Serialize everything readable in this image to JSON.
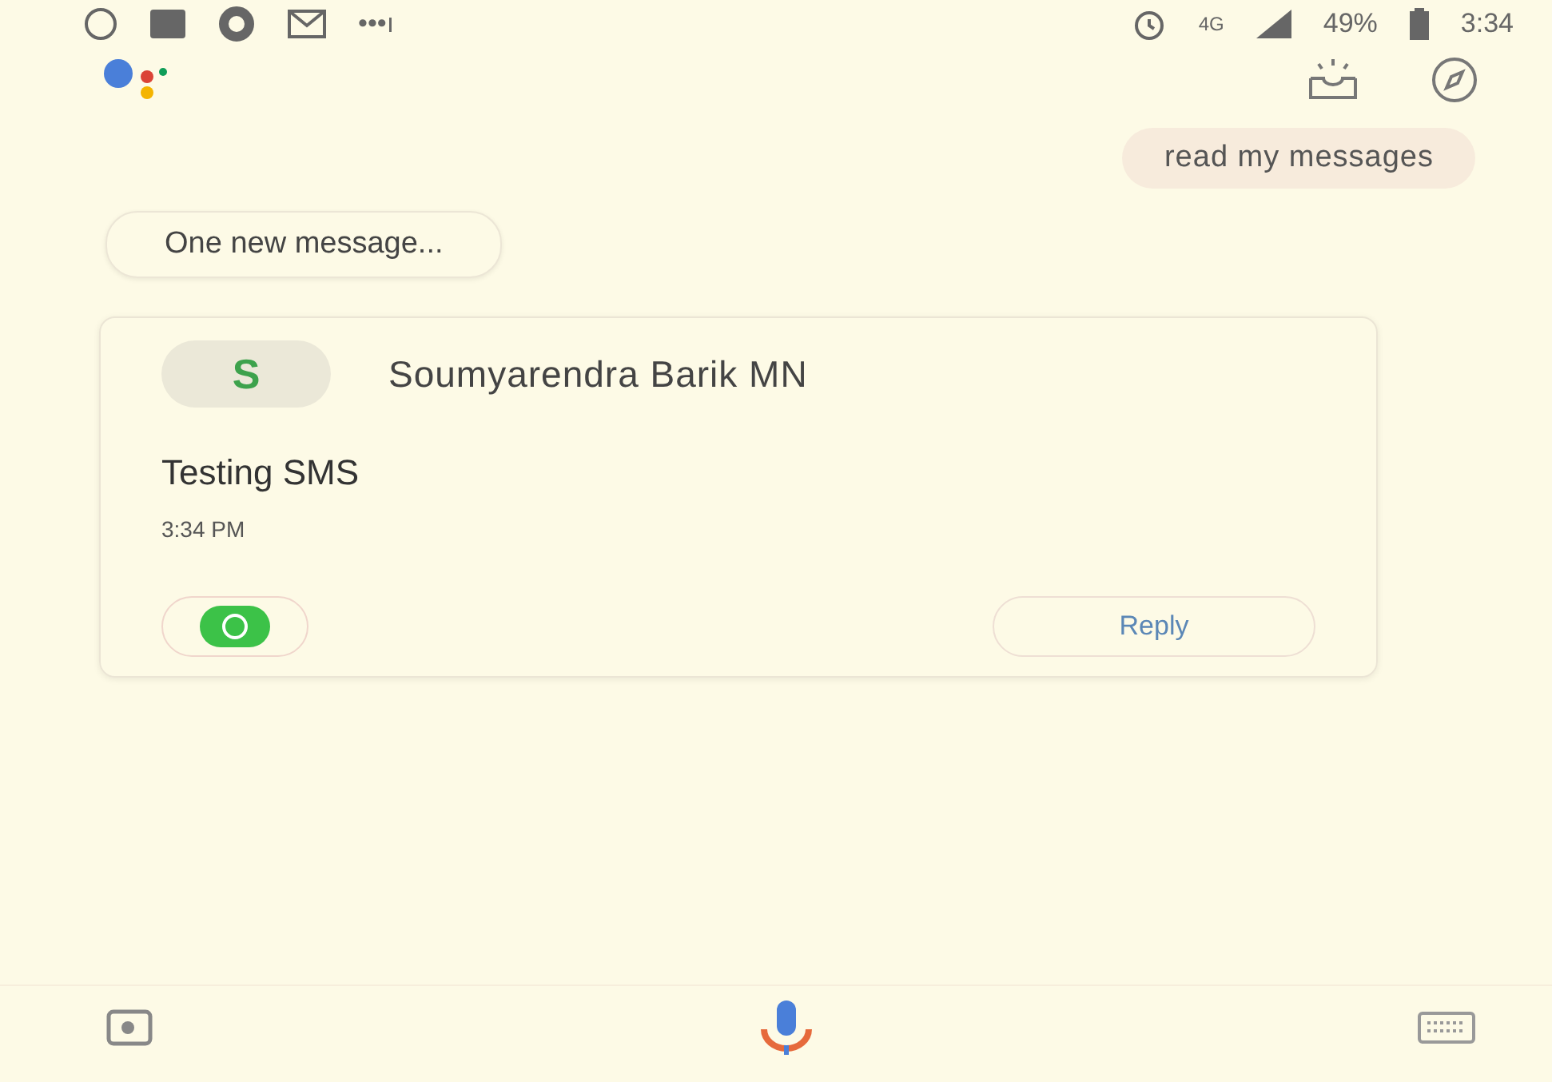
{
  "status_bar": {
    "more": "•••ı",
    "network": "4G",
    "battery": "49%",
    "time": "3:34"
  },
  "user_message": "read my messages",
  "assistant_message": "One new message...",
  "message_card": {
    "avatar_letter": "S",
    "sender": "Soumyarendra Barik MN",
    "body": "Testing SMS",
    "time": "3:34 PM",
    "reply_label": "Reply"
  }
}
